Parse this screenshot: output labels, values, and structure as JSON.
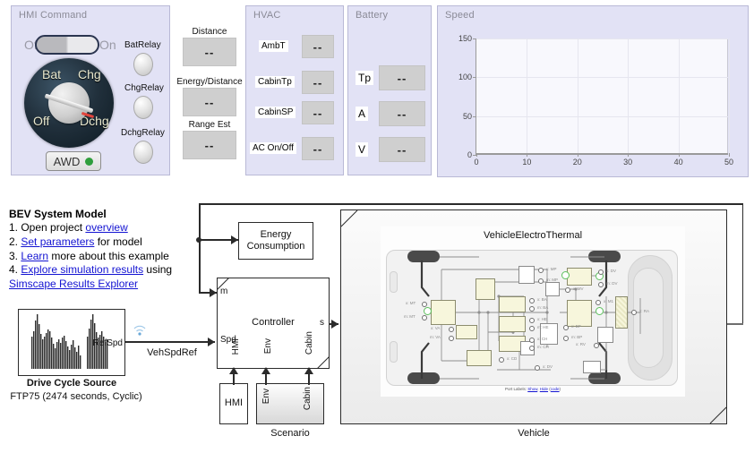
{
  "dashboard": {
    "hmi": {
      "title": "HMI Command",
      "toggle": {
        "off_label": "Off",
        "on_label": "On",
        "state": "off"
      },
      "knob": {
        "labels": [
          "Bat",
          "Chg",
          "Off",
          "Dchg"
        ],
        "selected": "Dchg"
      },
      "awd": {
        "label": "AWD",
        "lamp_color": "#2e9e3c"
      },
      "lamps": [
        {
          "label": "BatRelay"
        },
        {
          "label": "ChgRelay"
        },
        {
          "label": "DchgRelay"
        }
      ]
    },
    "readouts": [
      {
        "label": "Distance",
        "value": "--"
      },
      {
        "label": "Energy/Distance",
        "value": "--"
      },
      {
        "label": "Range Est",
        "value": "--"
      }
    ],
    "hvac": {
      "title": "HVAC",
      "rows": [
        {
          "label": "AmbT",
          "value": "--"
        },
        {
          "label": "CabinTp",
          "value": "--"
        },
        {
          "label": "CabinSP",
          "value": "--"
        },
        {
          "label": "AC On/Off",
          "value": "--"
        }
      ]
    },
    "battery": {
      "title": "Battery",
      "rows": [
        {
          "label": "Tp",
          "value": "--"
        },
        {
          "label": "A",
          "value": "--"
        },
        {
          "label": "V",
          "value": "--"
        }
      ]
    }
  },
  "chart_data": {
    "type": "line",
    "title": "Speed",
    "xlabel": "",
    "ylabel": "",
    "xlim": [
      0,
      50
    ],
    "ylim": [
      0,
      150
    ],
    "xticks": [
      0,
      10,
      20,
      30,
      40,
      50
    ],
    "yticks": [
      0,
      50,
      100,
      150
    ],
    "grid": true,
    "legend": "none",
    "series": [
      {
        "name": "Speed",
        "x": [],
        "y": []
      }
    ]
  },
  "info": {
    "title": "BEV System Model",
    "lines": [
      {
        "prefix": "1. Open project ",
        "link": "overview",
        "suffix": ""
      },
      {
        "prefix": "2. ",
        "link": "Set parameters",
        "suffix": " for model"
      },
      {
        "prefix": "3. ",
        "link": "Learn",
        "suffix": " more about this example"
      },
      {
        "prefix": "4. ",
        "link": "Explore simulation results",
        "suffix": " using"
      },
      {
        "prefix": " ",
        "link": "Simscape Results Explorer",
        "suffix": ""
      }
    ]
  },
  "model": {
    "drive_cycle": {
      "caption": "Drive Cycle Source",
      "subcaption": "FTP75 (2474  seconds, Cyclic)",
      "out_port": "RefSpd",
      "signal_label": "VehSpdRef"
    },
    "energy_consumption": {
      "label": "Energy\nConsumption"
    },
    "controller": {
      "label": "Controller",
      "in_ports": [
        "m",
        "Spd",
        "HMI",
        "Env",
        "Cabin"
      ],
      "out_ports": [
        "s"
      ]
    },
    "hmi_block": {
      "label": "HMI"
    },
    "scenario": {
      "caption": "Scenario",
      "out_ports": [
        "Env",
        "Cabin"
      ]
    },
    "vehicle": {
      "caption": "Vehicle",
      "title": "VehicleElectroThermal",
      "in_port": "s",
      "out_port": "m",
      "port_labels_text": "Port Labels:",
      "port_labels_links": [
        "Show",
        "Hide",
        "code"
      ],
      "subsystem_ports": [
        "x: MP",
        "m: MP",
        "x: MV",
        "x: DV",
        "m: DV",
        "x: BA",
        "m: BA",
        "x: HE",
        "m: HE",
        "x: CH",
        "m: CH",
        "x: BP",
        "m: BP",
        "x: MT",
        "m: MT",
        "x: VA",
        "m: VA",
        "x: CD",
        "x: DV",
        "x: RV",
        "x: RA",
        "x: M1"
      ]
    }
  }
}
